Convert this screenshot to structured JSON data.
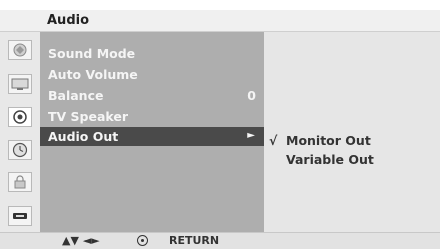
{
  "menu": {
    "title": "Audio",
    "items": [
      {
        "label": "Sound Mode",
        "value": ""
      },
      {
        "label": "Auto Volume",
        "value": ""
      },
      {
        "label": "Balance",
        "value": "0"
      },
      {
        "label": "TV Speaker",
        "value": ""
      },
      {
        "label": "Audio Out",
        "value": "",
        "arrow": "►"
      }
    ],
    "selected_index": 4
  },
  "submenu": {
    "items": [
      {
        "check": "√",
        "label": "Monitor Out"
      },
      {
        "check": "",
        "label": "Variable Out"
      }
    ]
  },
  "icons": [
    "picture-icon",
    "screen-icon",
    "speaker-icon",
    "clock-icon",
    "lock-icon",
    "input-icon"
  ],
  "footer": {
    "nav_hint": "▲▼ ◄►",
    "return_label": "RETURN"
  },
  "colors": {
    "menu_panel": "#aeaeae",
    "selected_row": "#4a4a4a",
    "submenu_panel": "#e6e6e6",
    "title_bar": "#f0f0f0"
  }
}
